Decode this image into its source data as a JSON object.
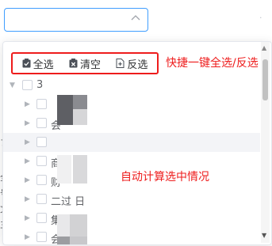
{
  "select": {
    "value": "",
    "arrow_icon": "chevron-up-icon"
  },
  "toolbar": {
    "select_all_label": "全选",
    "clear_label": "清空",
    "invert_label": "反选"
  },
  "annotations": {
    "toolbar_note": "快捷一键全选/反选",
    "tree_note": "自动计算选中情况"
  },
  "tree": {
    "root_label": "3",
    "items": [
      {
        "label": ""
      },
      {
        "label": "会"
      },
      {
        "label": ""
      },
      {
        "label": "商"
      },
      {
        "label": "财"
      },
      {
        "label": "二过     日"
      },
      {
        "label": "集       祝部"
      },
      {
        "label": "会"
      }
    ]
  },
  "colors": {
    "accent": "#409eff",
    "annotation": "#ee1c1c"
  }
}
